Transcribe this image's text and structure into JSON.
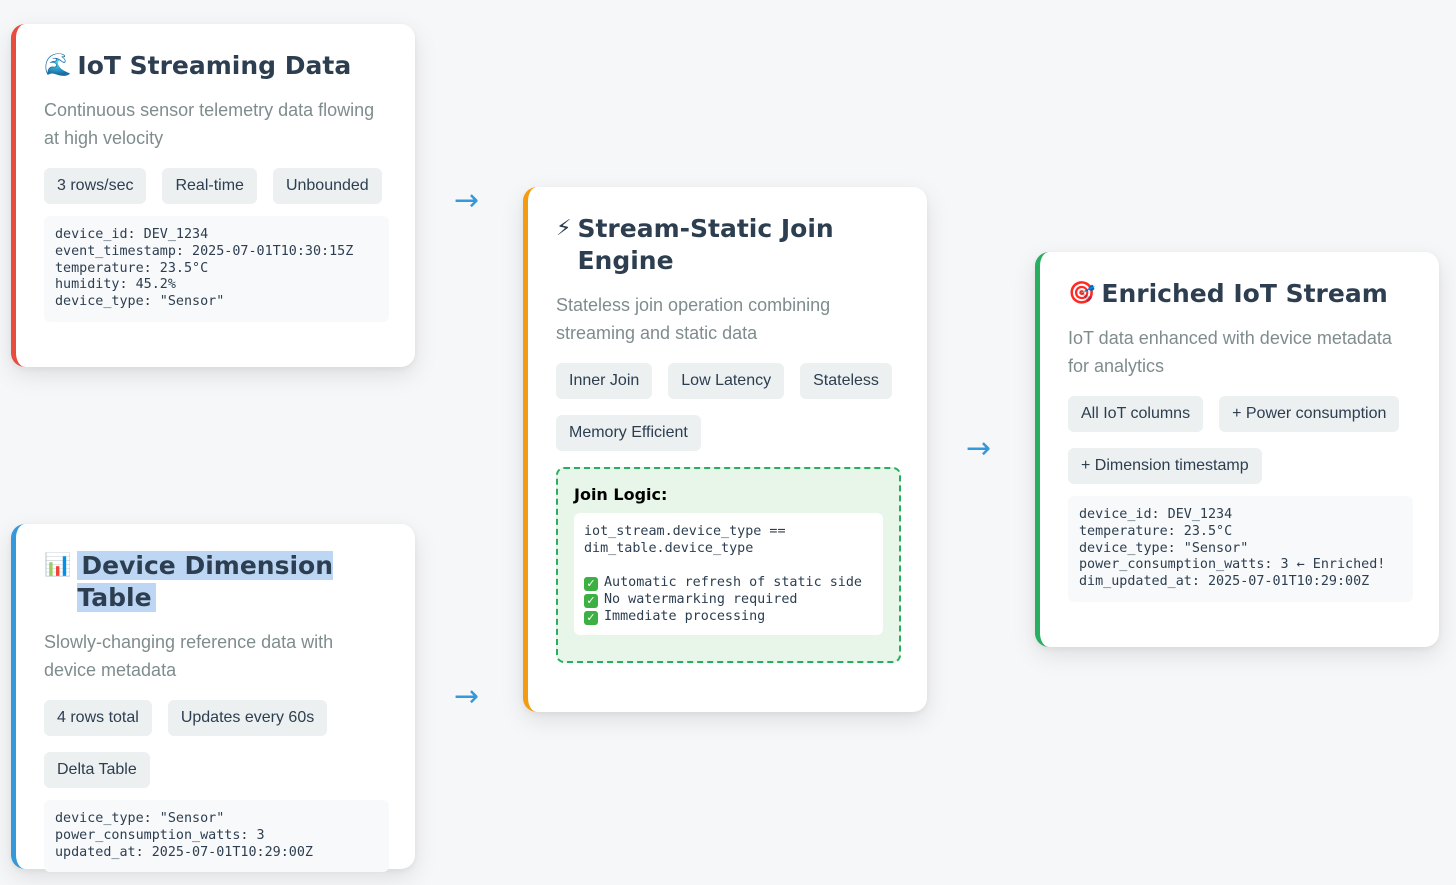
{
  "cards": {
    "iot_stream": {
      "icon": "🌊",
      "icon_name": "wave-icon",
      "title": "IoT Streaming Data",
      "description": "Continuous sensor telemetry data flowing at high velocity",
      "tags": [
        "3 rows/sec",
        "Real-time",
        "Unbounded"
      ],
      "code": "device_id: DEV_1234\nevent_timestamp: 2025-07-01T10:30:15Z\ntemperature: 23.5°C\nhumidity: 45.2%\ndevice_type: \"Sensor\"",
      "accent": "#e74c3c"
    },
    "dimension_table": {
      "icon": "📊",
      "icon_name": "bar-chart-icon",
      "title": "Device Dimension Table",
      "description": "Slowly-changing reference data with device metadata",
      "tags": [
        "4 rows total",
        "Updates every 60s",
        "Delta Table"
      ],
      "code": "device_type: \"Sensor\"\npower_consumption_watts: 3\nupdated_at: 2025-07-01T10:29:00Z",
      "accent": "#3498db"
    },
    "join_engine": {
      "icon": "⚡",
      "icon_name": "lightning-icon",
      "title": "Stream-Static Join Engine",
      "description": "Stateless join operation combining streaming and static data",
      "tags": [
        "Inner Join",
        "Low Latency",
        "Stateless",
        "Memory Efficient"
      ],
      "join_logic": {
        "title": "Join Logic:",
        "condition": "iot_stream.device_type ==\ndim_table.device_type",
        "checks": [
          "Automatic refresh of static side",
          "No watermarking required",
          "Immediate processing"
        ]
      },
      "accent": "#f39c12"
    },
    "enriched_stream": {
      "icon": "🎯",
      "icon_name": "target-icon",
      "title": "Enriched IoT Stream",
      "description": "IoT data enhanced with device metadata for analytics",
      "tags": [
        "All IoT columns",
        "+ Power consumption",
        "+ Dimension timestamp"
      ],
      "code": "device_id: DEV_1234\ntemperature: 23.5°C\ndevice_type: \"Sensor\"\npower_consumption_watts: 3 ← Enriched!\ndim_updated_at: 2025-07-01T10:29:00Z",
      "accent": "#27ae60"
    }
  },
  "arrows": {
    "glyph": "→",
    "color": "#3498db"
  }
}
